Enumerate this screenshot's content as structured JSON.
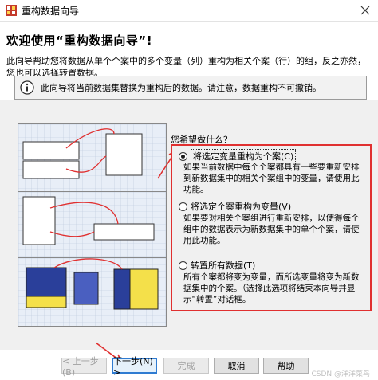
{
  "window": {
    "title": "重构数据向导"
  },
  "heading": "欢迎使用“重构数据向导”!",
  "intro": "此向导帮助您将数据从单个个案中的多个变量（列）重构为相关个案（行）的组，反之亦然，您也可以选择转置数据。",
  "info": {
    "text": "此向导将当前数据集替换为重构后的数据。请注意，数据重构不可撤销。"
  },
  "question": "您希望做什么？",
  "options": [
    {
      "label": "将选定变量重构为个案(C)",
      "description": "如果当前数据中每个个案都具有一些要重新安排到新数据集中的相关个案组中的变量，请使用此功能。"
    },
    {
      "label": "将选定个案重构为变量(V)",
      "description": "如果要对相关个案组进行重新安排，以使得每个组中的数据表示为新数据集中的单个个案，请使用此功能。"
    },
    {
      "label": "转置所有数据(T)",
      "description": "所有个案都将变为变量，而所选变量将变为新数据集中的个案。（选择此选项将结束本向导并显示“转置”对话框。"
    }
  ],
  "buttons": {
    "back": "< 上一步(B)",
    "next": "下一步(N) >",
    "finish": "完成",
    "cancel": "取消",
    "help": "帮助"
  },
  "watermark": "CSDN @洋洋菜鸟",
  "colors": {
    "accent": "#2f7bd1",
    "annotation": "#e03030"
  }
}
